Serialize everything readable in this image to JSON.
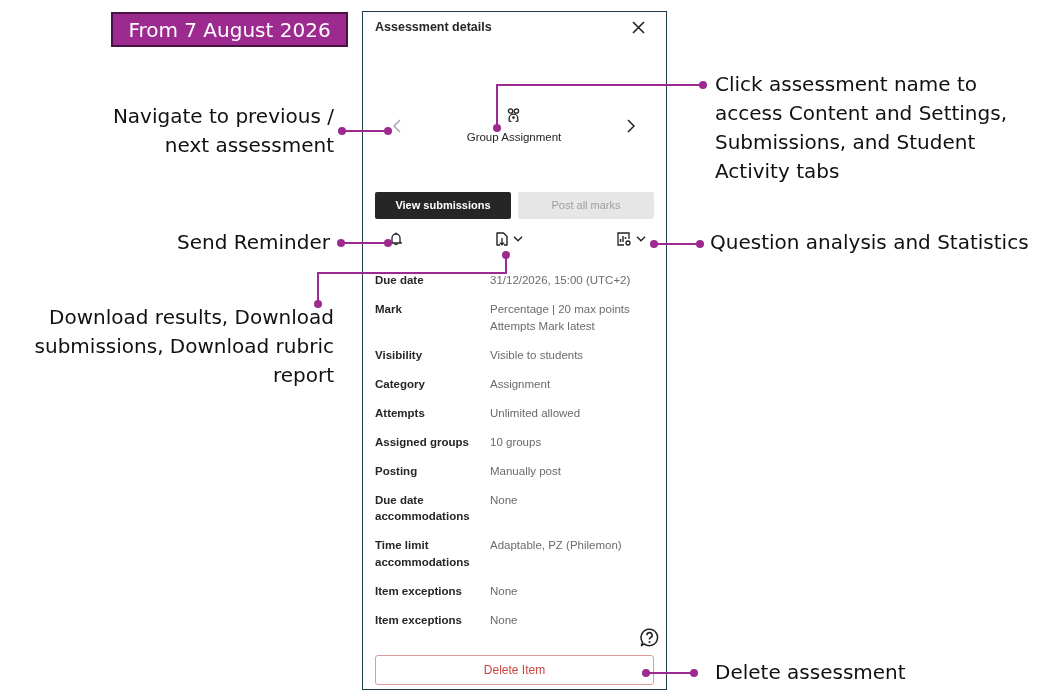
{
  "banner": {
    "text": "From 7 August 2026"
  },
  "callouts_left": [
    {
      "text": "Navigate to previous / next assessment"
    },
    {
      "text": "Send Reminder"
    },
    {
      "text": "Download results, Download submissions, Download rubric report"
    }
  ],
  "panel": {
    "title": "Assessment details",
    "navigation": [
      {
        "kind": "previous",
        "disabled": true
      },
      {
        "kind": "next",
        "disabled": false
      }
    ],
    "assessment_name": "Group Assignment",
    "buttons": [
      {
        "label": "View submissions",
        "disabled": false
      },
      {
        "label": "Post all marks",
        "disabled": true
      }
    ],
    "tools": [
      {
        "kind": "reminder",
        "has_menu": false
      },
      {
        "kind": "download",
        "has_menu": true
      },
      {
        "kind": "analysis",
        "has_menu": true
      }
    ],
    "details": [
      {
        "label": "Due date",
        "values": [
          "31/12/2026, 15:00 (UTC+2)"
        ]
      },
      {
        "label": "Mark",
        "values": [
          "Percentage | 20 max points",
          "Attempts Mark latest"
        ]
      },
      {
        "label": "Visibility",
        "values": [
          "Visible to students"
        ]
      },
      {
        "label": "Category",
        "values": [
          "Assignment"
        ]
      },
      {
        "label": "Attempts",
        "values": [
          "Unlimited allowed"
        ]
      },
      {
        "label": "Assigned groups",
        "values": [
          "10 groups"
        ]
      },
      {
        "label": "Posting",
        "values": [
          "Manually post"
        ]
      },
      {
        "label": "Due date accommodations",
        "values": [
          "None"
        ]
      },
      {
        "label": "Time limit accommodations",
        "values": [
          "Adaptable, PZ (Philemon)"
        ]
      },
      {
        "label": "Item exceptions",
        "values": [
          "None"
        ]
      },
      {
        "label": "Item exceptions",
        "values": [
          "None"
        ]
      }
    ],
    "delete_button": {
      "label": "Delete Item"
    }
  },
  "callouts_right": [
    {
      "text": "Click assessment name to access Content and Settings, Submissions, and Student Activity tabs"
    },
    {
      "text": "Question analysis and Statistics"
    },
    {
      "text": "Delete assessment"
    }
  ]
}
